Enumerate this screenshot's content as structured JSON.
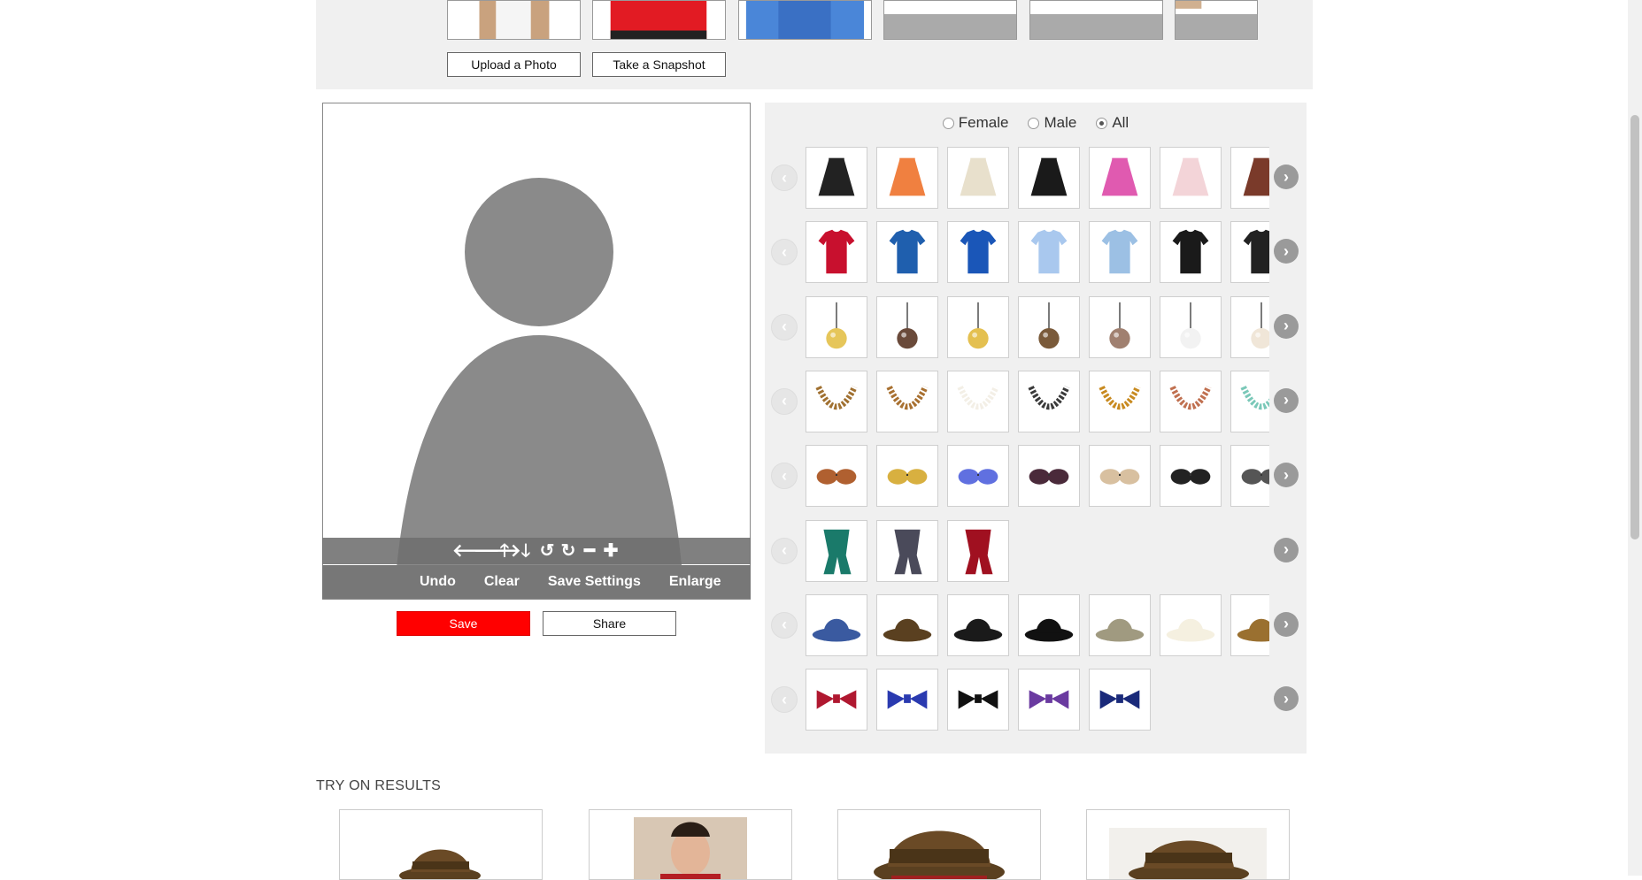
{
  "upload": {
    "upload_label": "Upload a Photo",
    "snapshot_label": "Take a Snapshot"
  },
  "editor": {
    "nudge_controls": [
      {
        "glyph": "🡐",
        "name": "move-left-icon"
      },
      {
        "glyph": "🡒",
        "name": "move-right-icon"
      },
      {
        "glyph": "🡑",
        "name": "move-up-icon"
      },
      {
        "glyph": "🡓",
        "name": "move-down-icon"
      },
      {
        "glyph": "↺",
        "name": "rotate-left-icon"
      },
      {
        "glyph": "↻",
        "name": "rotate-right-icon"
      },
      {
        "glyph": "━",
        "name": "shrink-icon"
      },
      {
        "glyph": "✚",
        "name": "grow-icon"
      }
    ],
    "toolbar": {
      "undo": "Undo",
      "clear": "Clear",
      "save_settings": "Save Settings",
      "enlarge": "Enlarge"
    },
    "save_label": "Save",
    "share_label": "Share"
  },
  "catalog": {
    "gender_options": [
      "Female",
      "Male",
      "All"
    ],
    "selected_gender": "All",
    "rows": [
      {
        "category": "skirts",
        "colors": [
          "#222222",
          "#f08040",
          "#e8e0cc",
          "#1a1a1a",
          "#e05ab0",
          "#f3d4d8",
          "#7a3a2a"
        ]
      },
      {
        "category": "tops",
        "colors": [
          "#c8102e",
          "#1f5fae",
          "#1a56b8",
          "#a9c8ee",
          "#9cc0e4",
          "#1a1a1a",
          "#222222"
        ]
      },
      {
        "category": "earrings",
        "colors": [
          "#e6c65a",
          "#6a4a3a",
          "#e4c050",
          "#7a5a3a",
          "#a08070",
          "#f2f2f2",
          "#f0e6d8"
        ]
      },
      {
        "category": "necklaces",
        "colors": [
          "#a07030",
          "#a87030",
          "#f3efe6",
          "#3a3a3a",
          "#c88a20",
          "#c07050",
          "#7ac8b8"
        ]
      },
      {
        "category": "sunglasses",
        "colors": [
          "#b06030",
          "#d8b040",
          "#6070e0",
          "#4a2a3a",
          "#d8c0a0",
          "#222222",
          "#555555"
        ]
      },
      {
        "category": "scarves",
        "colors": [
          "#1a7a6a",
          "#4a4a5a",
          "#a01020"
        ]
      },
      {
        "category": "hats",
        "colors": [
          "#3a5aa0",
          "#5a4020",
          "#1a1a1a",
          "#111111",
          "#a09a80",
          "#f5f0e0",
          "#9a7030"
        ]
      },
      {
        "category": "ties",
        "colors": [
          "#b01830",
          "#2a3ab0",
          "#111111",
          "#6a3aa0",
          "#1a2a7a"
        ]
      }
    ]
  },
  "results": {
    "title": "TRY ON RESULTS"
  }
}
